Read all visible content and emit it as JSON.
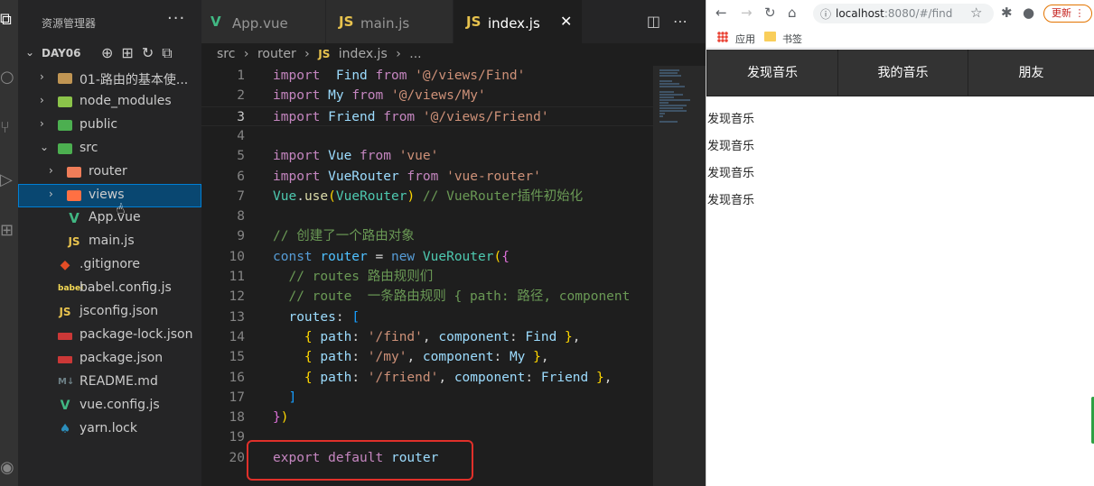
{
  "activity_bar": {
    "items": [
      {
        "name": "explorer-icon",
        "glyph": "⧉"
      },
      {
        "name": "search-icon",
        "glyph": "○"
      },
      {
        "name": "source-control-icon",
        "glyph": "⑂"
      },
      {
        "name": "run-icon",
        "glyph": "▷"
      },
      {
        "name": "extensions-icon",
        "glyph": "⊞"
      },
      {
        "name": "account-icon",
        "glyph": "◉"
      }
    ]
  },
  "sidebar": {
    "title": "资源管理器",
    "more": "···",
    "root_label": "DAY06",
    "root_actions": "⊕⊞↻⧉",
    "items": [
      {
        "label": "01-路由的基本使...",
        "depth": 1,
        "twisty": "›",
        "icon": "folder"
      },
      {
        "label": "node_modules",
        "depth": 1,
        "twisty": "›",
        "icon": "node"
      },
      {
        "label": "public",
        "depth": 1,
        "twisty": "›",
        "icon": "public"
      },
      {
        "label": "src",
        "depth": 1,
        "twisty": "⌄",
        "icon": "src"
      },
      {
        "label": "router",
        "depth": 2,
        "twisty": "›",
        "icon": "router"
      },
      {
        "label": "views",
        "depth": 2,
        "twisty": "›",
        "icon": "views",
        "selected": true
      },
      {
        "label": "App.vue",
        "depth": 2,
        "twisty": "",
        "icon": "vue"
      },
      {
        "label": "main.js",
        "depth": 2,
        "twisty": "",
        "icon": "js"
      },
      {
        "label": ".gitignore",
        "depth": 1,
        "twisty": "",
        "icon": "git"
      },
      {
        "label": "babel.config.js",
        "depth": 1,
        "twisty": "",
        "icon": "babel"
      },
      {
        "label": "jsconfig.json",
        "depth": 1,
        "twisty": "",
        "icon": "js"
      },
      {
        "label": "package-lock.json",
        "depth": 1,
        "twisty": "",
        "icon": "npm"
      },
      {
        "label": "package.json",
        "depth": 1,
        "twisty": "",
        "icon": "npm"
      },
      {
        "label": "README.md",
        "depth": 1,
        "twisty": "",
        "icon": "md"
      },
      {
        "label": "vue.config.js",
        "depth": 1,
        "twisty": "",
        "icon": "vcfg"
      },
      {
        "label": "yarn.lock",
        "depth": 1,
        "twisty": "",
        "icon": "yarn"
      }
    ]
  },
  "tabs": [
    {
      "label": "App.vue",
      "icon": "V",
      "icon_color": "#41b883",
      "active": false
    },
    {
      "label": "main.js",
      "icon": "JS",
      "icon_color": "#e8c34e",
      "active": false
    },
    {
      "label": "index.js",
      "icon": "JS",
      "icon_color": "#e8c34e",
      "active": true,
      "close": "✕"
    }
  ],
  "tab_actions": "◫⋯",
  "breadcrumb": {
    "parts": [
      "src",
      "›",
      "router",
      "›",
      "JS",
      "index.js",
      "›",
      "..."
    ]
  },
  "code": {
    "current_line": 3,
    "lines": [
      [
        [
          "ctl",
          "import"
        ],
        [
          "",
          "  "
        ],
        [
          "var",
          "Find"
        ],
        [
          "",
          ""
        ],
        [
          "ctl",
          " from"
        ],
        [
          "",
          ""
        ],
        [
          "str",
          " '@/views/Find'"
        ]
      ],
      [
        [
          "ctl",
          "import"
        ],
        [
          "var",
          " My"
        ],
        [
          "ctl",
          " from"
        ],
        [
          "str",
          " '@/views/My'"
        ]
      ],
      [
        [
          "ctl",
          "import"
        ],
        [
          "var",
          " Friend"
        ],
        [
          "ctl",
          " from"
        ],
        [
          "str",
          " '@/views/Friend'"
        ]
      ],
      [],
      [
        [
          "ctl",
          "import"
        ],
        [
          "var",
          " Vue"
        ],
        [
          "ctl",
          " from"
        ],
        [
          "str",
          " 'vue'"
        ]
      ],
      [
        [
          "ctl",
          "import"
        ],
        [
          "var",
          " VueRouter"
        ],
        [
          "ctl",
          " from"
        ],
        [
          "str",
          " 'vue-router'"
        ]
      ],
      [
        [
          "cls",
          "Vue"
        ],
        [
          "",
          "."
        ],
        [
          "fn",
          "use"
        ],
        [
          "brk",
          "("
        ],
        [
          "cls",
          "VueRouter"
        ],
        [
          "brk",
          ")"
        ],
        [
          "cmt",
          " // VueRouter插件初始化"
        ]
      ],
      [],
      [
        [
          "cmt",
          "// 创建了一个路由对象"
        ]
      ],
      [
        [
          "kw",
          "const"
        ],
        [
          "cvar",
          " router"
        ],
        [
          "",
          " = "
        ],
        [
          "kw",
          "new"
        ],
        [
          "cls",
          " VueRouter"
        ],
        [
          "brk",
          "("
        ],
        [
          "brk2",
          "{"
        ]
      ],
      [
        [
          "",
          "  "
        ],
        [
          "cmt",
          "// routes 路由规则们"
        ]
      ],
      [
        [
          "",
          "  "
        ],
        [
          "cmt",
          "// route  一条路由规则 { path: 路径, component"
        ]
      ],
      [
        [
          "",
          "  "
        ],
        [
          "prop",
          "routes"
        ],
        [
          "",
          ": "
        ],
        [
          "brk3",
          "["
        ]
      ],
      [
        [
          "",
          "    "
        ],
        [
          "brk",
          "{"
        ],
        [
          "prop",
          " path"
        ],
        [
          "",
          ": "
        ],
        [
          "str",
          "'/find'"
        ],
        [
          "",
          ", "
        ],
        [
          "prop",
          "component"
        ],
        [
          "",
          ": "
        ],
        [
          "var",
          "Find"
        ],
        [
          "brk",
          " }"
        ],
        [
          "",
          ","
        ]
      ],
      [
        [
          "",
          "    "
        ],
        [
          "brk",
          "{"
        ],
        [
          "prop",
          " path"
        ],
        [
          "",
          ": "
        ],
        [
          "str",
          "'/my'"
        ],
        [
          "",
          ", "
        ],
        [
          "prop",
          "component"
        ],
        [
          "",
          ": "
        ],
        [
          "var",
          "My"
        ],
        [
          "brk",
          " }"
        ],
        [
          "",
          ","
        ]
      ],
      [
        [
          "",
          "    "
        ],
        [
          "brk",
          "{"
        ],
        [
          "prop",
          " path"
        ],
        [
          "",
          ": "
        ],
        [
          "str",
          "'/friend'"
        ],
        [
          "",
          ", "
        ],
        [
          "prop",
          "component"
        ],
        [
          "",
          ": "
        ],
        [
          "var",
          "Friend"
        ],
        [
          "brk",
          " }"
        ],
        [
          "",
          ","
        ]
      ],
      [
        [
          "",
          "  "
        ],
        [
          "brk3",
          "]"
        ]
      ],
      [
        [
          "brk2",
          "}"
        ],
        [
          "brk",
          ")"
        ]
      ],
      [],
      [
        [
          "ctl",
          "export"
        ],
        [
          "ctl",
          " default"
        ],
        [
          "var",
          " router"
        ]
      ]
    ]
  },
  "browser": {
    "back": "←",
    "forward": "→",
    "reload": "↻",
    "home": "⌂",
    "info": "ⓘ",
    "url_host": "localhost",
    "url_rest": ":8080/#/find",
    "star": "☆",
    "extensions": "✱",
    "account": "●",
    "update_label": "更新",
    "update_more": "⋮",
    "bookmark_apps": "应用",
    "bookmark_folder": "书签",
    "nav_links": [
      "发现音乐",
      "我的音乐",
      "朋友"
    ],
    "page_lines": [
      "发现音乐",
      "发现音乐",
      "发现音乐",
      "发现音乐"
    ]
  }
}
